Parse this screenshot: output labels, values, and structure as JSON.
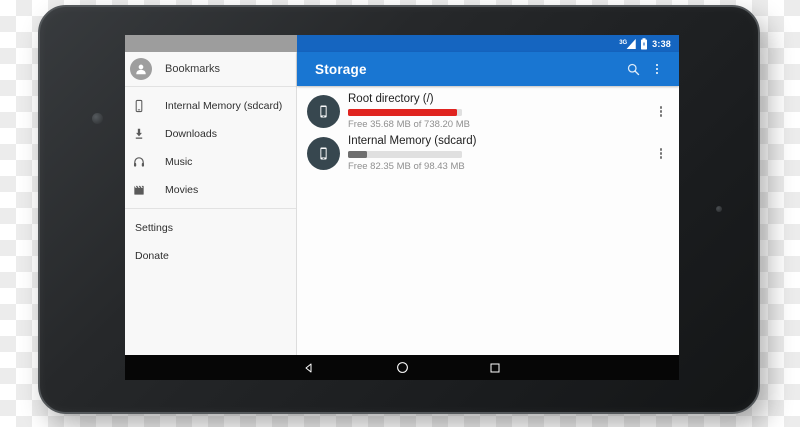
{
  "status_bar": {
    "time": "3:38",
    "network": "3G",
    "icons": [
      "cellular-signal-icon",
      "battery-icon"
    ]
  },
  "sidebar": {
    "header": {
      "label": "Bookmarks",
      "icon": "person-icon"
    },
    "items": [
      {
        "label": "Internal Memory (sdcard)",
        "icon": "smartphone-icon"
      },
      {
        "label": "Downloads",
        "icon": "download-icon"
      },
      {
        "label": "Music",
        "icon": "headphones-icon"
      },
      {
        "label": "Movies",
        "icon": "movie-icon"
      }
    ],
    "footer_items": [
      {
        "label": "Settings"
      },
      {
        "label": "Donate"
      }
    ]
  },
  "app_bar": {
    "title": "Storage",
    "icons": [
      "search-icon",
      "overflow-menu-icon"
    ]
  },
  "storage_list": {
    "items": [
      {
        "name": "Root directory (/)",
        "free_text": "Free 35.68 MB of 738.20 MB",
        "used_percent": 96,
        "bar_color": "#e02420",
        "icon": "smartphone-icon"
      },
      {
        "name": "Internal Memory (sdcard)",
        "free_text": "Free 82.35 MB of 98.43 MB",
        "used_percent": 17,
        "bar_color": "#6e6e6e",
        "icon": "smartphone-icon"
      }
    ]
  },
  "nav_bar": {
    "buttons": [
      "back",
      "home",
      "recents"
    ]
  },
  "colors": {
    "status_bar_blue": "#1565c0",
    "app_bar_blue": "#1976d2",
    "status_bar_gray": "#9d9d9d",
    "bar_track": "#e0e0e0",
    "list_icon_circle": "#37474f"
  }
}
